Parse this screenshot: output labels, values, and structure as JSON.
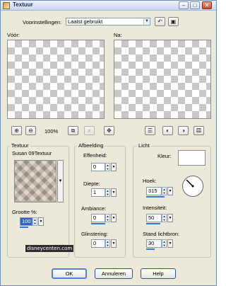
{
  "window": {
    "title": "Textuur"
  },
  "titlebar_buttons": {
    "minimize": "–",
    "maximize": "□",
    "close": "✕"
  },
  "presets": {
    "label": "Voorinstellingen:",
    "value": "Laatst gebruikt"
  },
  "preview": {
    "before_label": "Vóór:",
    "after_label": "Na:",
    "zoom_value": "100%"
  },
  "texture": {
    "group_label": "Textuur",
    "name": "Susan 09Textuur",
    "size_label": "Grootte %:",
    "size_value": "100",
    "size_level_percent": 30
  },
  "image": {
    "group_label": "Afbeelding",
    "relief_label": "Effenheid:",
    "relief_value": "0",
    "depth_label": "Diepte:",
    "depth_value": "1",
    "ambience_label": "Ambiance:",
    "ambience_value": "0",
    "shininess_label": "Glinstering:",
    "shininess_value": "0"
  },
  "light": {
    "group_label": "Licht",
    "color_label": "Kleur:",
    "color_value": "#ffffff",
    "angle_label": "Hoek:",
    "angle_value": "315",
    "intensity_label": "Intensiteit:",
    "intensity_value": "50",
    "elevation_label": "Stand lichtbron:",
    "elevation_value": "30"
  },
  "watermark": {
    "text": "disneycenten.com"
  },
  "buttons": {
    "ok": "OK",
    "cancel": "Annuleren",
    "help": "Help"
  },
  "colors": {
    "accent": "#3a78d6",
    "window_bg": "#ece9d8"
  }
}
